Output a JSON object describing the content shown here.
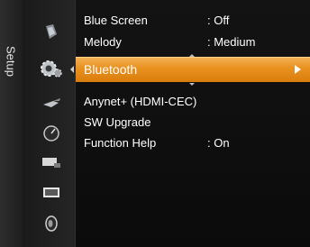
{
  "setup_tab": {
    "label": "Setup"
  },
  "icons": [
    {
      "name": "picture-icon"
    },
    {
      "name": "setup-gear-icon",
      "active": true
    },
    {
      "name": "input-icon"
    },
    {
      "name": "channel-icon"
    },
    {
      "name": "application-icon"
    },
    {
      "name": "pc-icon"
    },
    {
      "name": "sound-icon"
    }
  ],
  "menu": {
    "items": [
      {
        "label": "Blue Screen",
        "value": ": Off"
      },
      {
        "label": "Melody",
        "value": ": Medium"
      },
      {
        "label": "Bluetooth",
        "value": "",
        "selected": true
      },
      {
        "label": "Anynet+ (HDMI-CEC)",
        "value": ""
      },
      {
        "label": "SW Upgrade",
        "value": ""
      },
      {
        "label": "Function Help",
        "value": ": On"
      }
    ]
  },
  "colors": {
    "highlight": "#e9911f",
    "background": "#111111"
  }
}
